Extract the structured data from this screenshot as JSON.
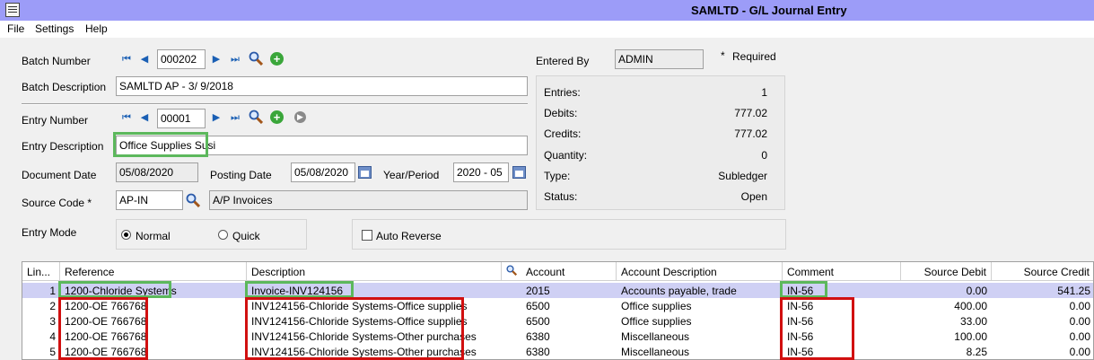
{
  "window": {
    "title": "SAMLTD - G/L Journal Entry"
  },
  "menu": [
    "File",
    "Settings",
    "Help"
  ],
  "batch": {
    "number_label": "Batch Number",
    "number": "000202",
    "desc_label": "Batch Description",
    "description": "SAMLTD AP -  3/ 9/2018"
  },
  "entered_by": {
    "label": "Entered By",
    "value": "ADMIN",
    "required_star": "*",
    "required_label": "Required"
  },
  "entry": {
    "number_label": "Entry Number",
    "number": "00001",
    "desc_label": "Entry Description",
    "description": "Office Supplies Susi",
    "doc_date_label": "Document Date",
    "doc_date": "05/08/2020",
    "posting_date_label": "Posting Date",
    "posting_date": "05/08/2020",
    "year_period_label": "Year/Period",
    "year_period": "2020 - 05",
    "source_code_label": "Source Code *",
    "source_code": "AP-IN",
    "source_desc": "A/P Invoices",
    "mode_label": "Entry Mode",
    "mode_normal": "Normal",
    "mode_quick": "Quick",
    "mode_selected": "Normal",
    "auto_reverse": "Auto Reverse"
  },
  "summary": [
    {
      "label": "Entries:",
      "value": "1"
    },
    {
      "label": "Debits:",
      "value": "777.02"
    },
    {
      "label": "Credits:",
      "value": "777.02"
    },
    {
      "label": "Quantity:",
      "value": "0"
    },
    {
      "label": "Type:",
      "value": "Subledger"
    },
    {
      "label": "Status:",
      "value": "Open"
    }
  ],
  "grid": {
    "headers": [
      "Lin...",
      "Reference",
      "Description",
      "Account",
      "Account Description",
      "Comment",
      "Source Debit",
      "Source Credit"
    ],
    "rows": [
      [
        "1",
        "1200-Chloride Systems",
        "Invoice-INV124156",
        "2015",
        "Accounts payable, trade",
        "IN-56",
        "0.00",
        "541.25"
      ],
      [
        "2",
        "1200-OE 766768",
        "INV124156-Chloride Systems-Office supplies",
        "6500",
        "Office supplies",
        "IN-56",
        "400.00",
        "0.00"
      ],
      [
        "3",
        "1200-OE 766768",
        "INV124156-Chloride Systems-Office supplies",
        "6500",
        "Office supplies",
        "IN-56",
        "33.00",
        "0.00"
      ],
      [
        "4",
        "1200-OE 766768",
        "INV124156-Chloride Systems-Other purchases",
        "6380",
        "Miscellaneous",
        "IN-56",
        "100.00",
        "0.00"
      ],
      [
        "5",
        "1200-OE 766768",
        "INV124156-Chloride Systems-Other purchases",
        "6380",
        "Miscellaneous",
        "IN-56",
        "8.25",
        "0.00"
      ]
    ]
  },
  "colors": {
    "title_bar": "#9c9cf8",
    "selected_row": "#cfd0f4",
    "highlight_green": "#5cb85c",
    "highlight_red": "#d11010"
  }
}
